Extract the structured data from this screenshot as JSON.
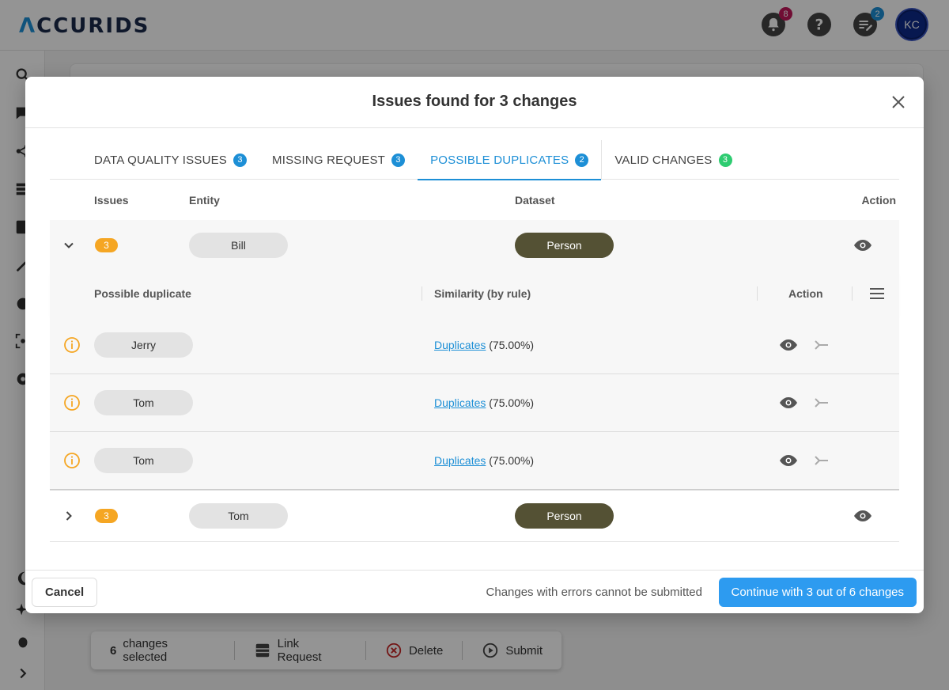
{
  "app": {
    "logo_text": "CCURIDS",
    "logo_mark": "Λ",
    "notifications_count": "8",
    "tasks_count": "2",
    "avatar_initials": "KC",
    "colors": {
      "accent": "#1d8fd6",
      "notification_badge": "#c2185b",
      "tasks_badge": "#1d8fd6",
      "avatar": "#0d2a8a"
    }
  },
  "sidebar": {
    "icons": [
      "search-icon",
      "chat-icon",
      "graph-icon",
      "list-icon",
      "database-icon",
      "magic-wand-icon",
      "chart-icon",
      "scan-icon",
      "gear-icon",
      "moon-icon",
      "sparkle-icon",
      "bug-icon",
      "chevron-right-icon"
    ]
  },
  "bottom_bar": {
    "count": "6",
    "selected_label": "changes selected",
    "link_request_label": "Link Request",
    "delete_label": "Delete",
    "submit_label": "Submit"
  },
  "modal": {
    "title": "Issues found for 3 changes",
    "tabs": [
      {
        "label": "DATA QUALITY ISSUES",
        "count": "3",
        "badge_color": "#1d8fd6",
        "active": false
      },
      {
        "label": "MISSING REQUEST",
        "count": "3",
        "badge_color": "#1d8fd6",
        "active": false
      },
      {
        "label": "POSSIBLE DUPLICATES",
        "count": "2",
        "badge_color": "#1d8fd6",
        "active": true
      },
      {
        "label": "VALID CHANGES",
        "count": "3",
        "badge_color": "#2ecc71",
        "active": false
      }
    ],
    "table": {
      "headers": {
        "issues": "Issues",
        "entity": "Entity",
        "dataset": "Dataset",
        "action": "Action"
      },
      "groups": [
        {
          "count": "3",
          "entity": "Bill",
          "dataset": "Person",
          "expanded": true,
          "sub_headers": {
            "possible_duplicate": "Possible duplicate",
            "similarity": "Similarity (by rule)",
            "action": "Action"
          },
          "duplicates": [
            {
              "name": "Jerry",
              "link_text": "Duplicates",
              "percent": "(75.00%)"
            },
            {
              "name": "Tom",
              "link_text": "Duplicates",
              "percent": "(75.00%)"
            },
            {
              "name": "Tom",
              "link_text": "Duplicates",
              "percent": "(75.00%)"
            }
          ]
        },
        {
          "count": "3",
          "entity": "Tom",
          "dataset": "Person",
          "expanded": false
        }
      ]
    },
    "footer": {
      "cancel_label": "Cancel",
      "message": "Changes with errors cannot be submitted",
      "continue_label": "Continue with 3 out of 6 changes"
    }
  }
}
